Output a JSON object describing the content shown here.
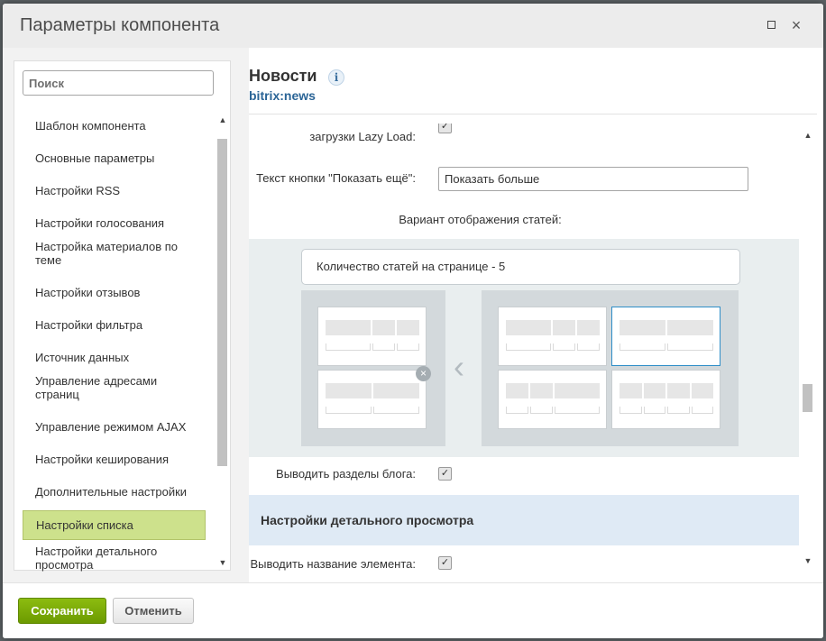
{
  "window": {
    "title": "Параметры компонента"
  },
  "sidebar": {
    "search_placeholder": "Поиск",
    "items": [
      {
        "label": "Шаблон компонента"
      },
      {
        "label": "Основные параметры"
      },
      {
        "label": "Настройки RSS"
      },
      {
        "label": "Настройки голосования"
      },
      {
        "label": "Настройка материалов по теме"
      },
      {
        "label": "Настройки отзывов"
      },
      {
        "label": "Настройки фильтра"
      },
      {
        "label": "Источник данных"
      },
      {
        "label": "Управление адресами страниц"
      },
      {
        "label": "Управление режимом AJAX"
      },
      {
        "label": "Настройки кеширования"
      },
      {
        "label": "Дополнительные настройки"
      },
      {
        "label": "Настройки списка",
        "active": true
      },
      {
        "label": "Настройки детального просмотра"
      }
    ]
  },
  "component": {
    "title": "Новости",
    "code": "bitrix:news",
    "info_icon": "info-icon"
  },
  "form": {
    "lazy_load_label": "загрузки Lazy Load:",
    "lazy_load_checked": true,
    "show_more_label": "Текст кнопки \"Показать ещё\":",
    "show_more_value": "Показать больше",
    "view_variant_label": "Вариант отображения статей:",
    "count_label": "Количество статей на странице - 5",
    "show_blog_sections_label": "Выводить разделы блога:",
    "show_blog_sections_checked": true,
    "detail_section_title": "Настройки детального просмотра",
    "show_element_name_label": "Выводить название элемента:",
    "show_element_name_checked": true
  },
  "footer": {
    "save_label": "Сохранить",
    "cancel_label": "Отменить"
  },
  "colors": {
    "active_item": "#cde18c",
    "save_button": "#7aaa06",
    "section_header": "#dfeaf5",
    "selected_tile": "#2e8ec8"
  }
}
